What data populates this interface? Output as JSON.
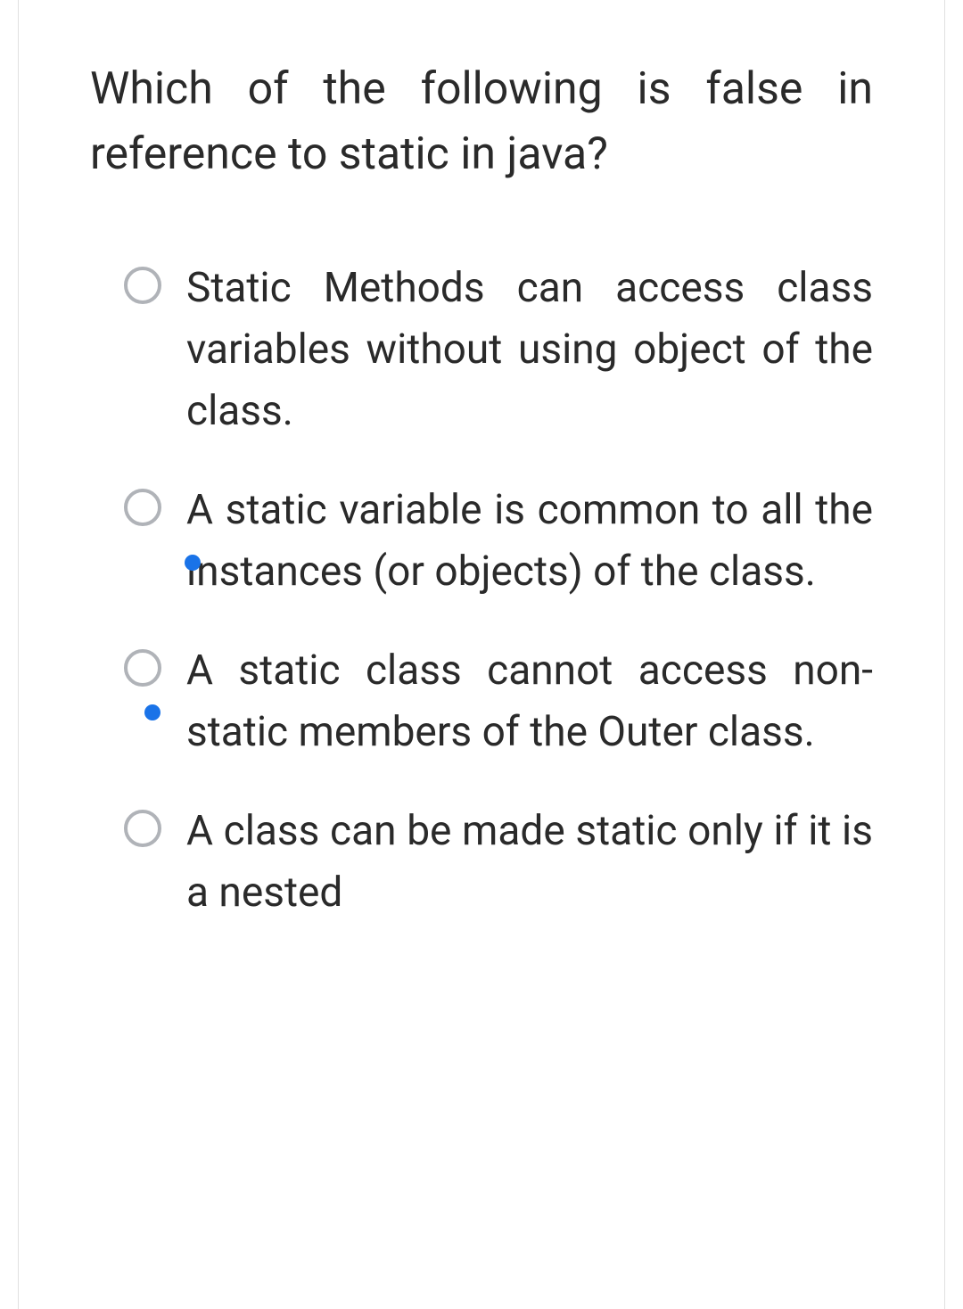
{
  "question": "Which of the following is false in reference to static in java?",
  "options": [
    {
      "text": "Static Methods can access class variables without using object of the class.",
      "hasBlueDot": false
    },
    {
      "text": "A static variable is common to all the instances (or objects) of the class.",
      "hasBlueDot": true,
      "dotClass": "blue-dot-1"
    },
    {
      "text": "A static class cannot access non-static members of the Outer class.",
      "hasBlueDot": true,
      "dotClass": "blue-dot-2"
    },
    {
      "text": "A class can be made static only if it is a nested",
      "hasBlueDot": false
    }
  ]
}
